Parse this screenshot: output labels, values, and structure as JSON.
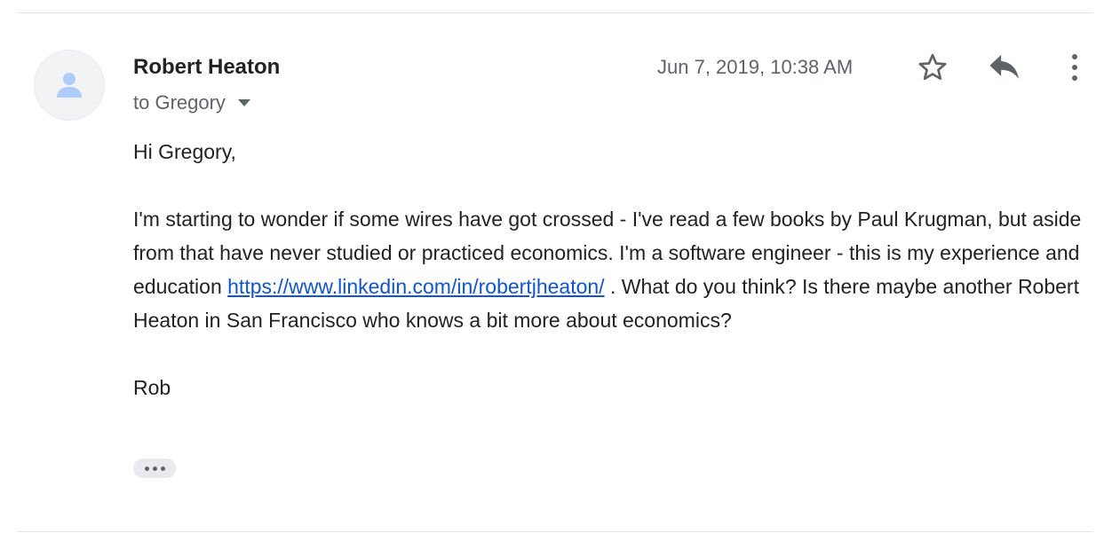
{
  "message": {
    "sender_name": "Robert Heaton",
    "recipient_line": "to Gregory",
    "timestamp": "Jun 7, 2019, 10:38 AM",
    "body": {
      "greeting": "Hi Gregory,",
      "paragraph_before_link": "I'm starting to wonder if some wires have got crossed - I've read a few books by Paul Krugman, but aside from that have never studied or practiced economics. I'm a software engineer - this is my experience and education ",
      "link_text": "https://www.linkedin.com/in/robertjheaton/",
      "paragraph_after_link": " . What do you think? Is there maybe another Robert Heaton in San Francisco who knows a bit more about economics?",
      "signature": "Rob"
    }
  },
  "icons": {
    "avatar": "person-icon",
    "recipient_caret": "caret-down-icon",
    "star": "star-outline-icon",
    "reply": "reply-icon",
    "more": "more-vertical-icon",
    "show_trimmed": "ellipsis-icon"
  },
  "colors": {
    "link": "#1155cc",
    "muted_text": "#5f6368",
    "avatar_person": "#aecbfa"
  }
}
